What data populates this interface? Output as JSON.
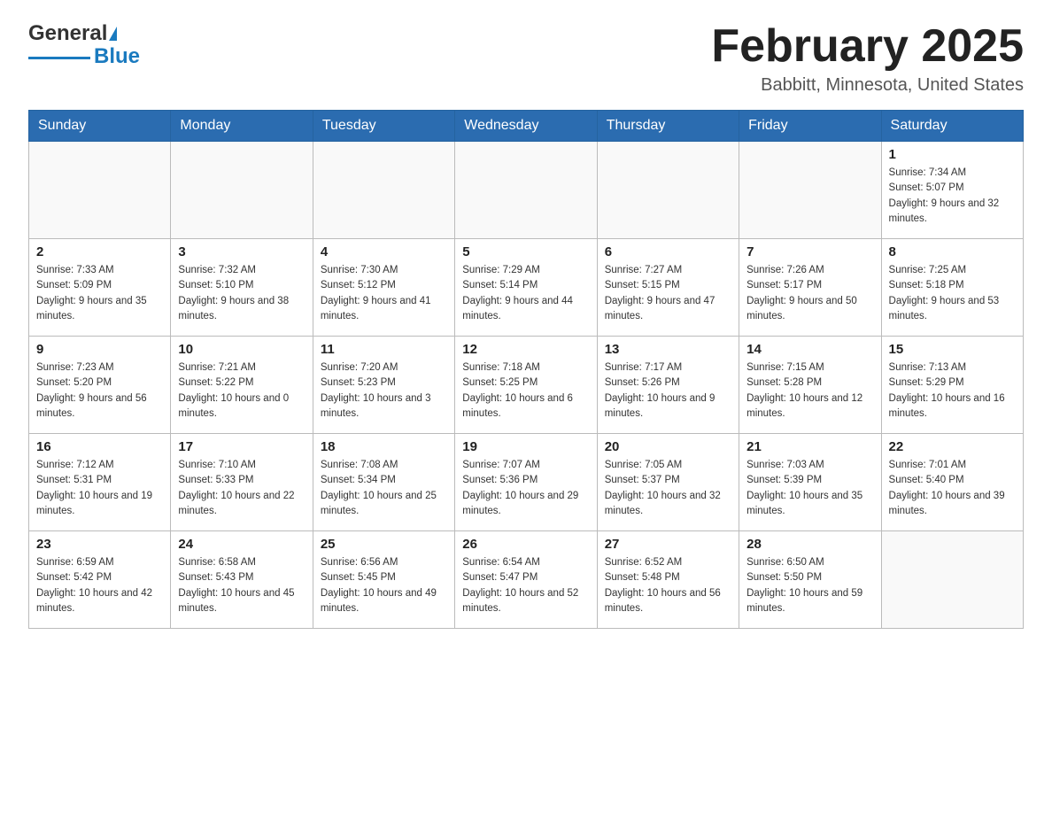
{
  "header": {
    "logo_main": "General",
    "logo_accent": "Blue",
    "month_title": "February 2025",
    "location": "Babbitt, Minnesota, United States"
  },
  "days_of_week": [
    "Sunday",
    "Monday",
    "Tuesday",
    "Wednesday",
    "Thursday",
    "Friday",
    "Saturday"
  ],
  "weeks": [
    [
      {
        "day": "",
        "info": ""
      },
      {
        "day": "",
        "info": ""
      },
      {
        "day": "",
        "info": ""
      },
      {
        "day": "",
        "info": ""
      },
      {
        "day": "",
        "info": ""
      },
      {
        "day": "",
        "info": ""
      },
      {
        "day": "1",
        "info": "Sunrise: 7:34 AM\nSunset: 5:07 PM\nDaylight: 9 hours and 32 minutes."
      }
    ],
    [
      {
        "day": "2",
        "info": "Sunrise: 7:33 AM\nSunset: 5:09 PM\nDaylight: 9 hours and 35 minutes."
      },
      {
        "day": "3",
        "info": "Sunrise: 7:32 AM\nSunset: 5:10 PM\nDaylight: 9 hours and 38 minutes."
      },
      {
        "day": "4",
        "info": "Sunrise: 7:30 AM\nSunset: 5:12 PM\nDaylight: 9 hours and 41 minutes."
      },
      {
        "day": "5",
        "info": "Sunrise: 7:29 AM\nSunset: 5:14 PM\nDaylight: 9 hours and 44 minutes."
      },
      {
        "day": "6",
        "info": "Sunrise: 7:27 AM\nSunset: 5:15 PM\nDaylight: 9 hours and 47 minutes."
      },
      {
        "day": "7",
        "info": "Sunrise: 7:26 AM\nSunset: 5:17 PM\nDaylight: 9 hours and 50 minutes."
      },
      {
        "day": "8",
        "info": "Sunrise: 7:25 AM\nSunset: 5:18 PM\nDaylight: 9 hours and 53 minutes."
      }
    ],
    [
      {
        "day": "9",
        "info": "Sunrise: 7:23 AM\nSunset: 5:20 PM\nDaylight: 9 hours and 56 minutes."
      },
      {
        "day": "10",
        "info": "Sunrise: 7:21 AM\nSunset: 5:22 PM\nDaylight: 10 hours and 0 minutes."
      },
      {
        "day": "11",
        "info": "Sunrise: 7:20 AM\nSunset: 5:23 PM\nDaylight: 10 hours and 3 minutes."
      },
      {
        "day": "12",
        "info": "Sunrise: 7:18 AM\nSunset: 5:25 PM\nDaylight: 10 hours and 6 minutes."
      },
      {
        "day": "13",
        "info": "Sunrise: 7:17 AM\nSunset: 5:26 PM\nDaylight: 10 hours and 9 minutes."
      },
      {
        "day": "14",
        "info": "Sunrise: 7:15 AM\nSunset: 5:28 PM\nDaylight: 10 hours and 12 minutes."
      },
      {
        "day": "15",
        "info": "Sunrise: 7:13 AM\nSunset: 5:29 PM\nDaylight: 10 hours and 16 minutes."
      }
    ],
    [
      {
        "day": "16",
        "info": "Sunrise: 7:12 AM\nSunset: 5:31 PM\nDaylight: 10 hours and 19 minutes."
      },
      {
        "day": "17",
        "info": "Sunrise: 7:10 AM\nSunset: 5:33 PM\nDaylight: 10 hours and 22 minutes."
      },
      {
        "day": "18",
        "info": "Sunrise: 7:08 AM\nSunset: 5:34 PM\nDaylight: 10 hours and 25 minutes."
      },
      {
        "day": "19",
        "info": "Sunrise: 7:07 AM\nSunset: 5:36 PM\nDaylight: 10 hours and 29 minutes."
      },
      {
        "day": "20",
        "info": "Sunrise: 7:05 AM\nSunset: 5:37 PM\nDaylight: 10 hours and 32 minutes."
      },
      {
        "day": "21",
        "info": "Sunrise: 7:03 AM\nSunset: 5:39 PM\nDaylight: 10 hours and 35 minutes."
      },
      {
        "day": "22",
        "info": "Sunrise: 7:01 AM\nSunset: 5:40 PM\nDaylight: 10 hours and 39 minutes."
      }
    ],
    [
      {
        "day": "23",
        "info": "Sunrise: 6:59 AM\nSunset: 5:42 PM\nDaylight: 10 hours and 42 minutes."
      },
      {
        "day": "24",
        "info": "Sunrise: 6:58 AM\nSunset: 5:43 PM\nDaylight: 10 hours and 45 minutes."
      },
      {
        "day": "25",
        "info": "Sunrise: 6:56 AM\nSunset: 5:45 PM\nDaylight: 10 hours and 49 minutes."
      },
      {
        "day": "26",
        "info": "Sunrise: 6:54 AM\nSunset: 5:47 PM\nDaylight: 10 hours and 52 minutes."
      },
      {
        "day": "27",
        "info": "Sunrise: 6:52 AM\nSunset: 5:48 PM\nDaylight: 10 hours and 56 minutes."
      },
      {
        "day": "28",
        "info": "Sunrise: 6:50 AM\nSunset: 5:50 PM\nDaylight: 10 hours and 59 minutes."
      },
      {
        "day": "",
        "info": ""
      }
    ]
  ]
}
